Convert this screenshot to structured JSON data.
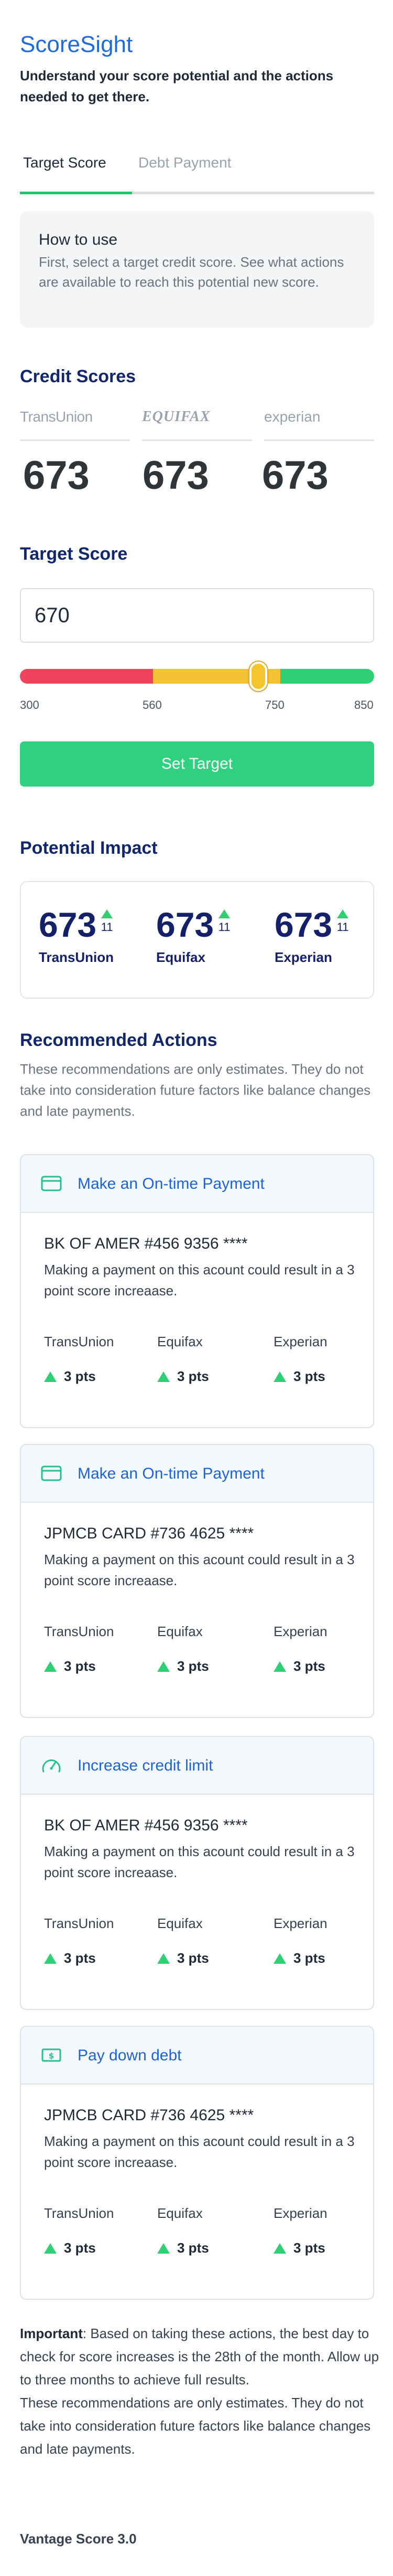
{
  "header": {
    "app_title": "ScoreSight",
    "subtitle": "Understand your score potential and the actions needed to get there."
  },
  "tabs": [
    {
      "label": "Target Score",
      "active": true
    },
    {
      "label": "Debt Payment",
      "active": false
    }
  ],
  "how_to_use": {
    "title": "How to use",
    "body": "First, select a target credit score. See what actions are available to reach this potential new score."
  },
  "credit_scores": {
    "title": "Credit Scores",
    "bureaus": [
      {
        "logo_text": "TransUnion",
        "score": "673"
      },
      {
        "logo_text": "EQUIFAX",
        "score": "673"
      },
      {
        "logo_text": "experian",
        "score": "673"
      }
    ]
  },
  "target_score": {
    "title": "Target Score",
    "input_value": "670",
    "range_ticks": [
      "300",
      "560",
      "750",
      "850"
    ],
    "slider_value": 670,
    "range_min": 300,
    "range_max": 850,
    "button_label": "Set Target"
  },
  "potential_impact": {
    "title": "Potential Impact",
    "items": [
      {
        "score": "673",
        "delta": "11",
        "bureau": "TransUnion"
      },
      {
        "score": "673",
        "delta": "11",
        "bureau": "Equifax"
      },
      {
        "score": "673",
        "delta": "11",
        "bureau": "Experian"
      }
    ]
  },
  "recommended": {
    "title": "Recommended Actions",
    "note": "These recommendations are only estimates. They do not take into consideration future factors like balance changes and late payments.",
    "actions": [
      {
        "icon": "credit-card-icon",
        "title": "Make an On-time Payment",
        "account": "BK OF AMER #456 9356 ****",
        "description": "Making a payment on this acount could result in a 3 point score increaase.",
        "bureaus": [
          "TransUnion",
          "Equifax",
          "Experian"
        ],
        "points": [
          "3 pts",
          "3 pts",
          "3 pts"
        ]
      },
      {
        "icon": "credit-card-icon",
        "title": "Make an On-time Payment",
        "account": "JPMCB CARD #736 4625 ****",
        "description": "Making a payment on this acount could result in a 3 point score increaase.",
        "bureaus": [
          "TransUnion",
          "Equifax",
          "Experian"
        ],
        "points": [
          "3 pts",
          "3 pts",
          "3 pts"
        ]
      },
      {
        "icon": "speedometer-icon",
        "title": "Increase credit limit",
        "account": "BK OF AMER #456 9356 ****",
        "description": "Making a payment on this acount could result in a 3 point score increaase.",
        "bureaus": [
          "TransUnion",
          "Equifax",
          "Experian"
        ],
        "points": [
          "3 pts",
          "3 pts",
          "3 pts"
        ]
      },
      {
        "icon": "dollar-bill-icon",
        "title": "Pay down debt",
        "account": "JPMCB CARD #736 4625 ****",
        "description": "Making a payment on this acount could result in a 3 point score increaase.",
        "bureaus": [
          "TransUnion",
          "Equifax",
          "Experian"
        ],
        "points": [
          "3 pts",
          "3 pts",
          "3 pts"
        ]
      }
    ]
  },
  "footer": {
    "important_label": "Important",
    "important_text": ": Based on taking these actions, the best day to check for score increases is the 28th of the month. Allow up to three months to achieve full results.",
    "disclaimer": "These recommendations are only estimates.  They do not take into consideration future factors like balance changes and late payments.",
    "model": "Vantage Score 3.0"
  },
  "colors": {
    "brand_blue": "#1e6be0",
    "navy": "#12276b",
    "success_green": "#2fd07e",
    "range_red": "#f0445e",
    "range_yellow": "#f2c233",
    "range_green": "#2fcf73"
  }
}
